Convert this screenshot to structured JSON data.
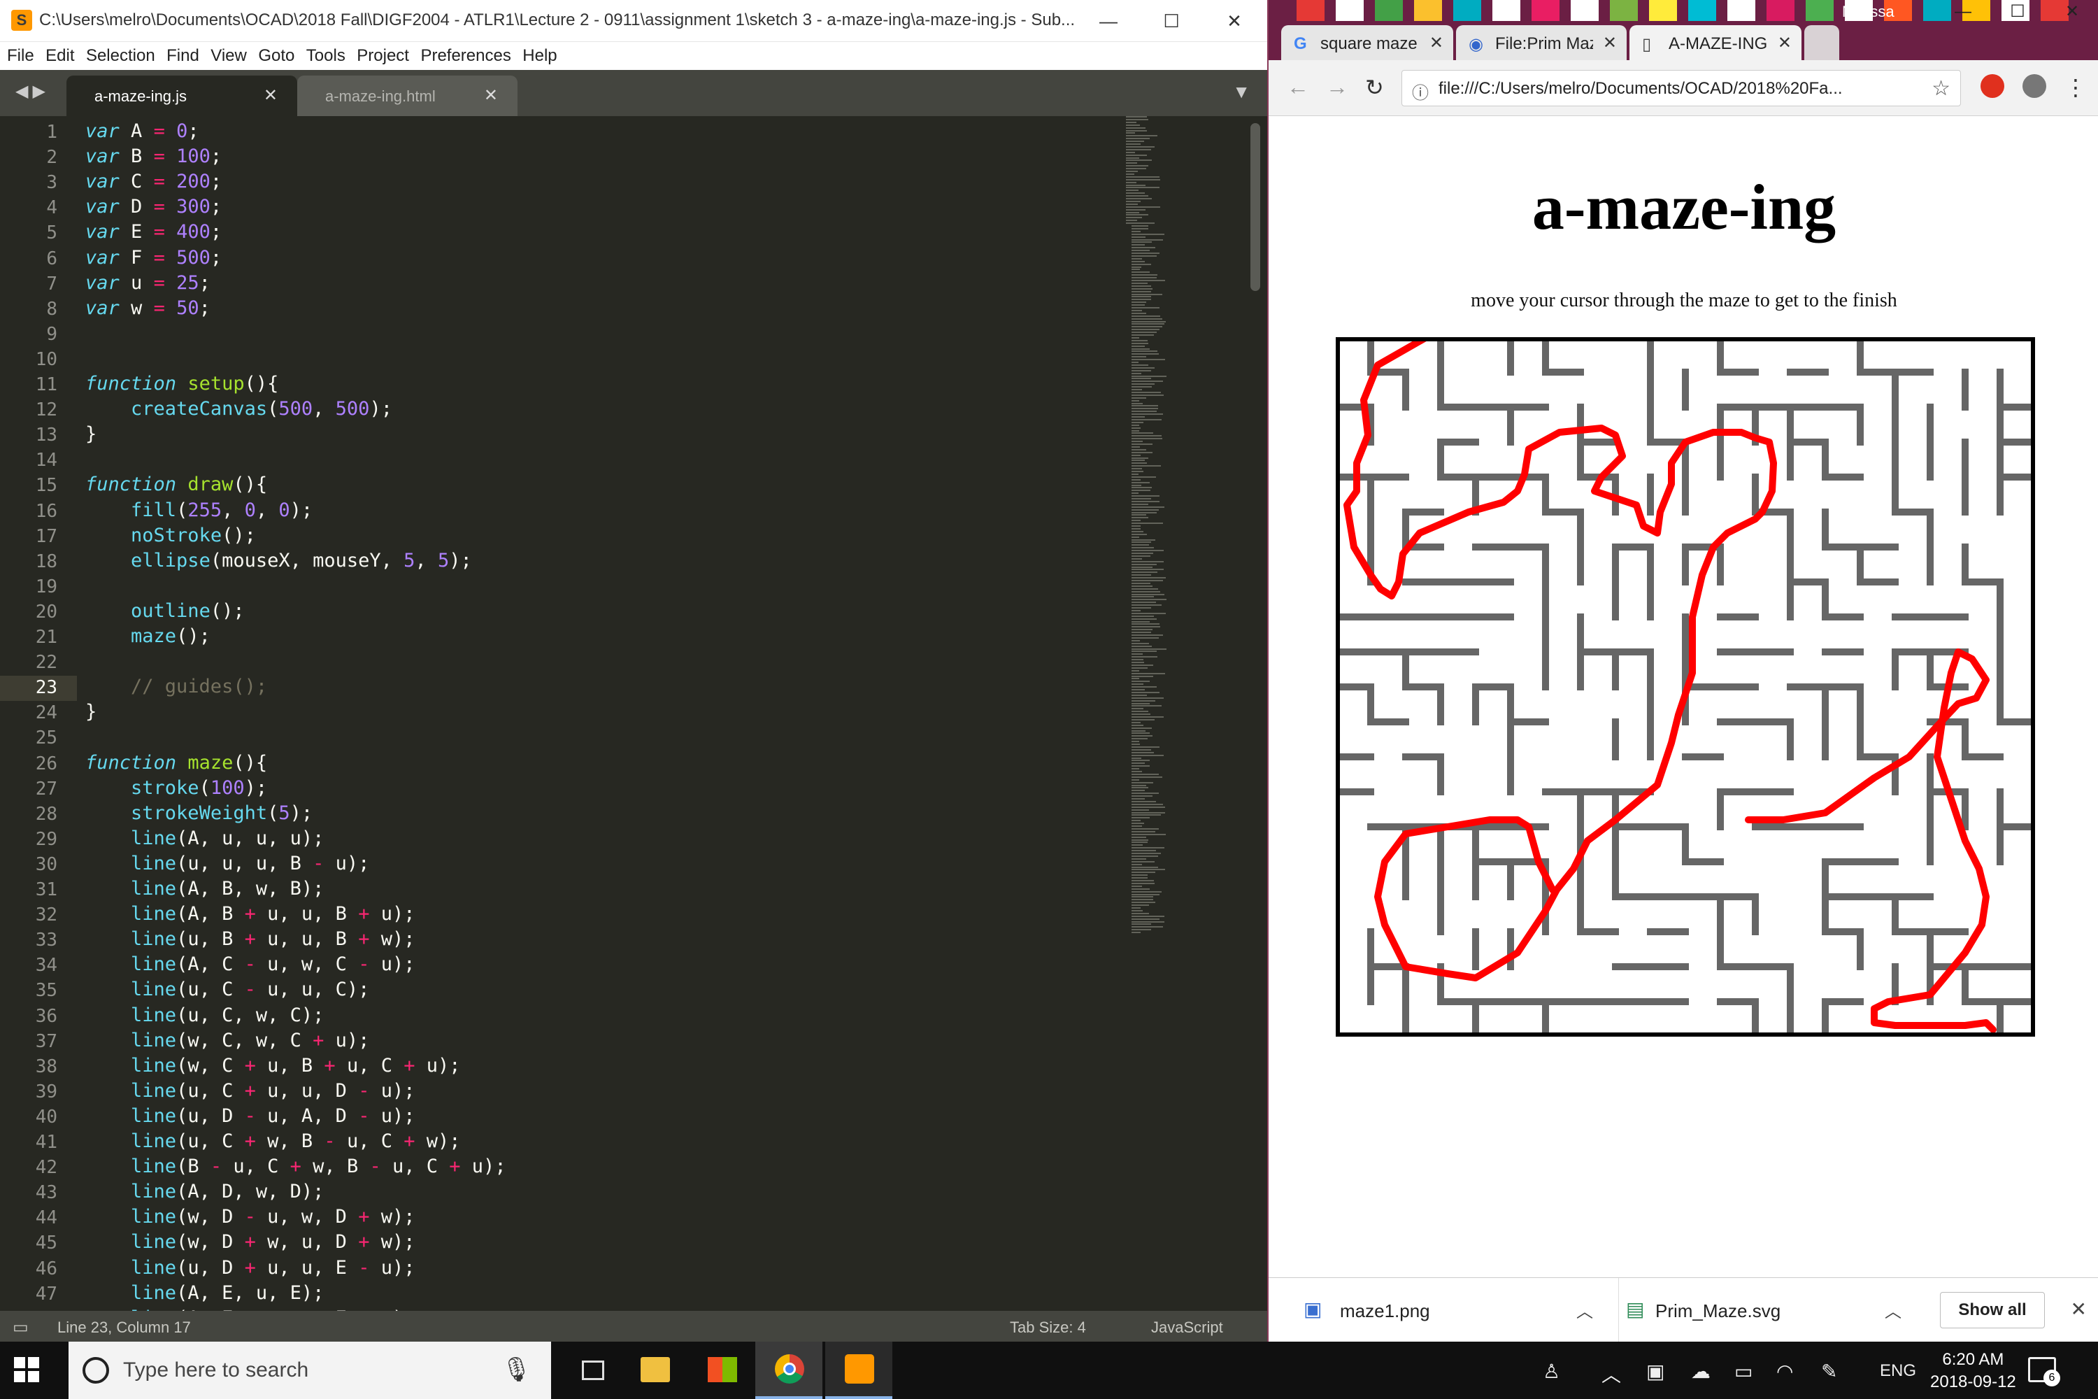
{
  "sublime": {
    "title": "C:\\Users\\melro\\Documents\\OCAD\\2018 Fall\\DIGF2004 - ATLR1\\Lecture 2 - 0911\\assignment 1\\sketch 3 - a-maze-ing\\a-maze-ing.js - Sub...",
    "menu": [
      "File",
      "Edit",
      "Selection",
      "Find",
      "View",
      "Goto",
      "Tools",
      "Project",
      "Preferences",
      "Help"
    ],
    "tabs": [
      {
        "label": "a-maze-ing.js",
        "active": true
      },
      {
        "label": "a-maze-ing.html",
        "active": false
      }
    ],
    "highlighted_line": 23,
    "code": [
      "var A = 0;",
      "var B = 100;",
      "var C = 200;",
      "var D = 300;",
      "var E = 400;",
      "var F = 500;",
      "var u = 25;",
      "var w = 50;",
      "",
      "",
      "function setup(){",
      "    createCanvas(500, 500);",
      "}",
      "",
      "function draw(){",
      "    fill(255, 0, 0);",
      "    noStroke();",
      "    ellipse(mouseX, mouseY, 5, 5);",
      "",
      "    outline();",
      "    maze();",
      "",
      "    // guides();",
      "}",
      "",
      "function maze(){",
      "    stroke(100);",
      "    strokeWeight(5);",
      "    line(A, u, u, u);",
      "    line(u, u, u, B - u);",
      "    line(A, B, w, B);",
      "    line(A, B + u, u, B + u);",
      "    line(u, B + u, u, B + w);",
      "    line(A, C - u, w, C - u);",
      "    line(u, C - u, u, C);",
      "    line(u, C, w, C);",
      "    line(w, C, w, C + u);",
      "    line(w, C + u, B + u, C + u);",
      "    line(u, C + u, u, D - u);",
      "    line(u, D - u, A, D - u);",
      "    line(u, C + w, B - u, C + w);",
      "    line(B - u, C + w, B - u, C + u);",
      "    line(A, D, w, D);",
      "    line(w, D - u, w, D + w);",
      "    line(w, D + w, u, D + w);",
      "    line(u, D + u, u, E - u);",
      "    line(A, E, u, E);",
      "    line(A, E - u, u, E - u);"
    ],
    "status": {
      "position": "Line 23, Column 17",
      "tab_size": "Tab Size: 4",
      "syntax": "JavaScript"
    }
  },
  "chrome": {
    "profile": "Melissa",
    "tabs": [
      {
        "label": "square maze",
        "icon": "google-g-icon"
      },
      {
        "label": "File:Prim Maz",
        "icon": "wikimedia-icon"
      },
      {
        "label": "A-MAZE-ING",
        "icon": "document-icon"
      }
    ],
    "url": "file:///C:/Users/melro/Documents/OCAD/2018%20Fa...",
    "page": {
      "title": "a-maze-ing",
      "subtitle": "move your cursor through the maze to get to the finish"
    },
    "downloads": [
      {
        "label": "maze1.png"
      },
      {
        "label": "Prim_Maze.svg"
      }
    ],
    "show_all": "Show all"
  },
  "taskbar": {
    "search_placeholder": "Type here to search",
    "language": "ENG",
    "time": "6:20 AM",
    "date": "2018-09-12",
    "notifications": "6"
  },
  "colors": {
    "maze_wall": "#666666",
    "cursor_trail": "#ff0000",
    "editor_bg": "#272822"
  }
}
